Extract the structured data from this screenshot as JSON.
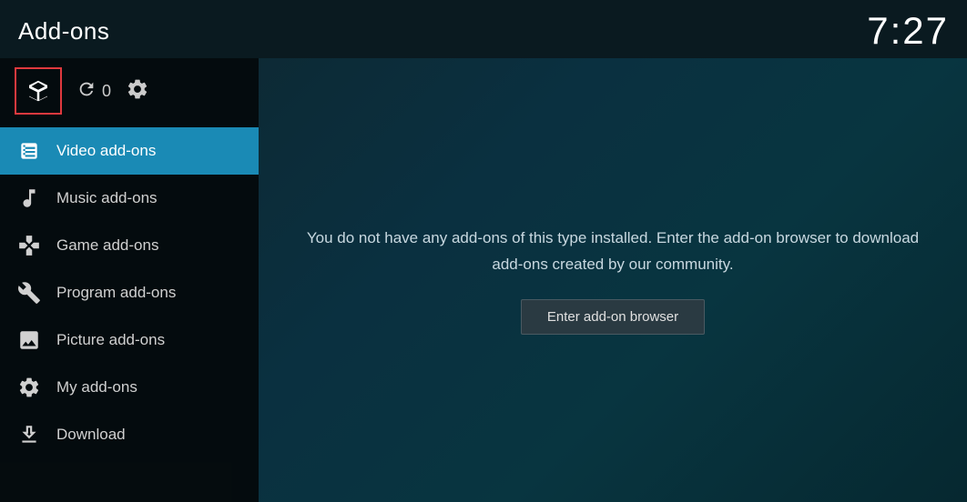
{
  "header": {
    "title": "Add-ons",
    "time": "7:27"
  },
  "toolbar": {
    "refresh_count": "0"
  },
  "nav": {
    "items": [
      {
        "id": "video-addons",
        "label": "Video add-ons",
        "icon": "video-icon",
        "active": true
      },
      {
        "id": "music-addons",
        "label": "Music add-ons",
        "icon": "music-icon",
        "active": false
      },
      {
        "id": "game-addons",
        "label": "Game add-ons",
        "icon": "game-icon",
        "active": false
      },
      {
        "id": "program-addons",
        "label": "Program add-ons",
        "icon": "program-icon",
        "active": false
      },
      {
        "id": "picture-addons",
        "label": "Picture add-ons",
        "icon": "picture-icon",
        "active": false
      },
      {
        "id": "my-addons",
        "label": "My add-ons",
        "icon": "myaddon-icon",
        "active": false
      },
      {
        "id": "download",
        "label": "Download",
        "icon": "download-icon",
        "active": false
      }
    ]
  },
  "content": {
    "message": "You do not have any add-ons of this type installed. Enter the add-on browser to\ndownload add-ons created by our community.",
    "browser_button": "Enter add-on browser"
  }
}
